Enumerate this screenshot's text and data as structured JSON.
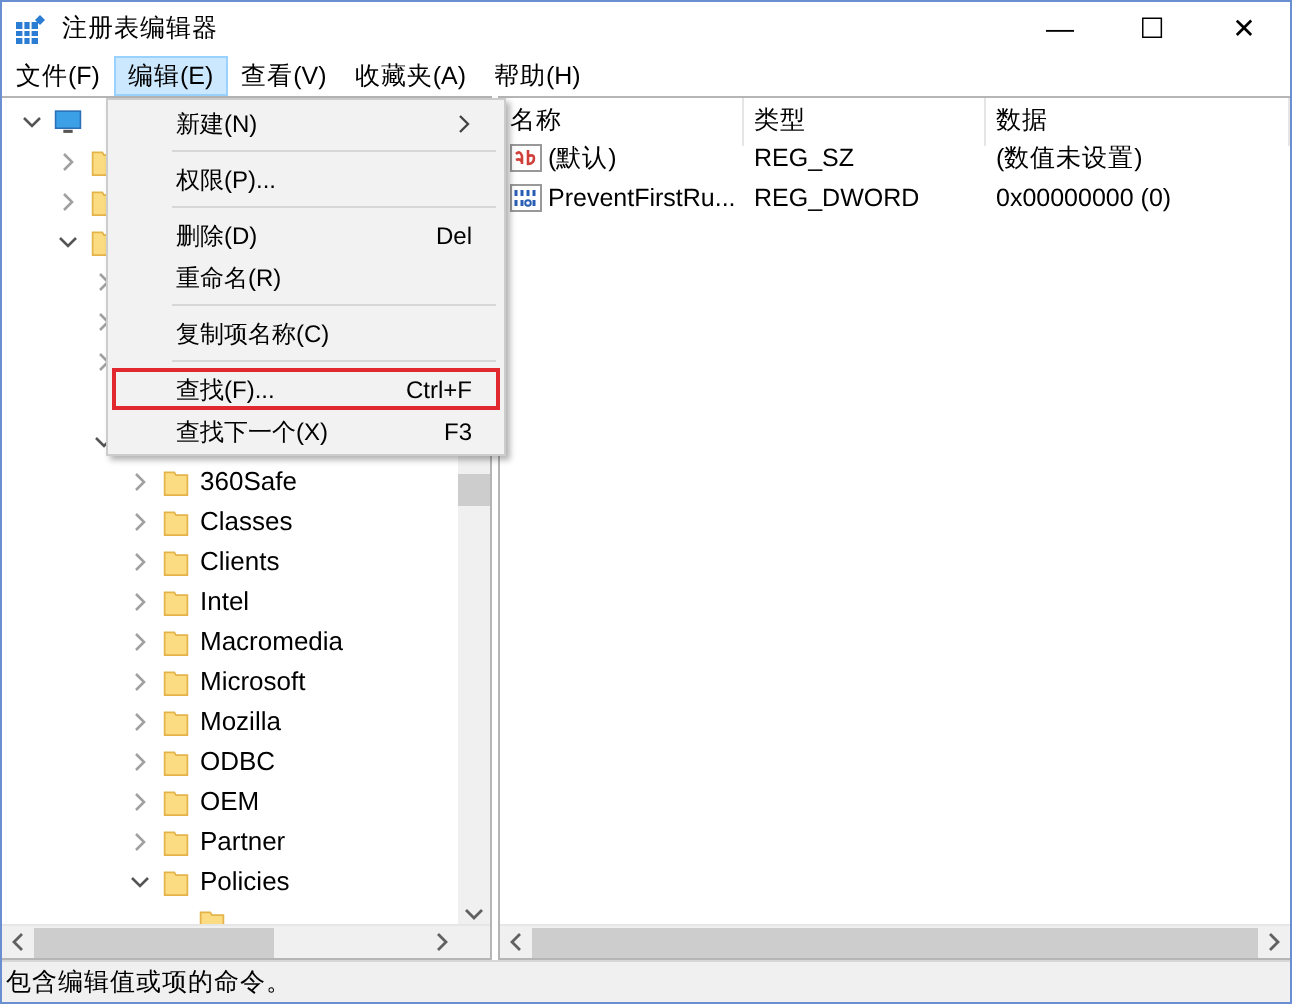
{
  "window": {
    "title": "注册表编辑器",
    "controls": [
      "—",
      "☐",
      "✕"
    ]
  },
  "menu_bar": [
    {
      "label": "文件(F)",
      "selected": false
    },
    {
      "label": "编辑(E)",
      "selected": true
    },
    {
      "label": "查看(V)",
      "selected": false
    },
    {
      "label": "收藏夹(A)",
      "selected": false
    },
    {
      "label": "帮助(H)",
      "selected": false
    }
  ],
  "edit_menu": [
    {
      "kind": "item",
      "label": "新建(N)",
      "submenu": true,
      "highlighted": false
    },
    {
      "kind": "separator"
    },
    {
      "kind": "item",
      "label": "权限(P)...",
      "highlighted": false
    },
    {
      "kind": "separator"
    },
    {
      "kind": "item",
      "label": "删除(D)",
      "shortcut": "Del",
      "highlighted": false
    },
    {
      "kind": "item",
      "label": "重命名(R)",
      "highlighted": false
    },
    {
      "kind": "separator"
    },
    {
      "kind": "item",
      "label": "复制项名称(C)",
      "highlighted": false
    },
    {
      "kind": "separator"
    },
    {
      "kind": "item",
      "label": "查找(F)...",
      "shortcut": "Ctrl+F",
      "highlighted": true
    },
    {
      "kind": "item",
      "label": "查找下一个(X)",
      "shortcut": "F3",
      "highlighted": false
    }
  ],
  "tree": [
    {
      "kind": "computer",
      "expanded": true,
      "children": [
        {
          "kind": "folder",
          "expanded": false
        },
        {
          "kind": "folder",
          "expanded": false
        },
        {
          "kind": "folder",
          "expanded": true,
          "children": [
            {
              "kind": "covered",
              "expanded": false
            },
            {
              "kind": "covered",
              "expanded": false
            },
            {
              "kind": "covered",
              "expanded": false
            },
            {
              "kind": "hidden"
            },
            {
              "kind": "covered",
              "expanded": true,
              "children": [
                {
                  "kind": "folder",
                  "label": "360Safe",
                  "expanded": false
                },
                {
                  "kind": "folder",
                  "label": "Classes",
                  "expanded": false
                },
                {
                  "kind": "folder",
                  "label": "Clients",
                  "expanded": false
                },
                {
                  "kind": "folder",
                  "label": "Intel",
                  "expanded": false
                },
                {
                  "kind": "folder",
                  "label": "Macromedia",
                  "expanded": false
                },
                {
                  "kind": "folder",
                  "label": "Microsoft",
                  "expanded": false
                },
                {
                  "kind": "folder",
                  "label": "Mozilla",
                  "expanded": false
                },
                {
                  "kind": "folder",
                  "label": "ODBC",
                  "expanded": false
                },
                {
                  "kind": "folder",
                  "label": "OEM",
                  "expanded": false
                },
                {
                  "kind": "folder",
                  "label": "Partner",
                  "expanded": false
                },
                {
                  "kind": "folder",
                  "label": "Policies",
                  "expanded": true,
                  "children": [
                    {
                      "kind": "folder"
                    }
                  ]
                }
              ]
            }
          ]
        }
      ]
    }
  ],
  "values_table": {
    "columns": [
      "名称",
      "类型",
      "数据"
    ],
    "rows": [
      {
        "kind": "string",
        "name": "(默认)",
        "type": "REG_SZ",
        "data": "(数值未设置)"
      },
      {
        "kind": "dword",
        "name": "PreventFirstRu...",
        "type": "REG_DWORD",
        "data": "0x00000000 (0)"
      }
    ]
  },
  "status_bar": "包含编辑值或项的命令。"
}
